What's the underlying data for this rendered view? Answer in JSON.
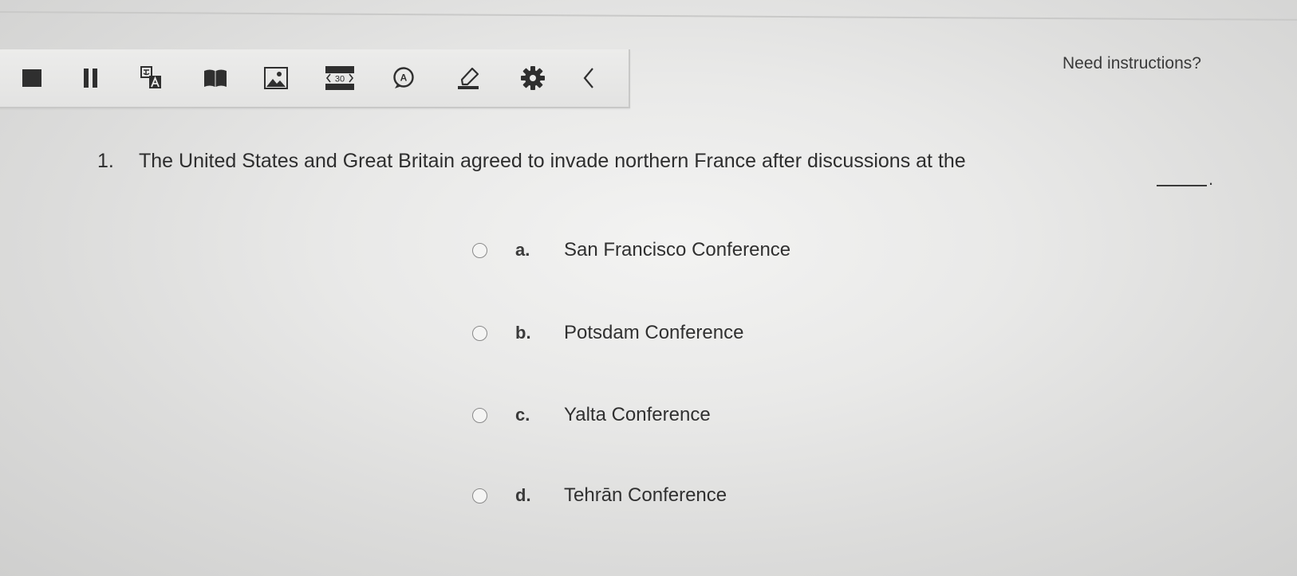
{
  "toolbar": {
    "tools": [
      {
        "icon": "stop-icon"
      },
      {
        "icon": "pause-icon"
      },
      {
        "icon": "translate-icon"
      },
      {
        "icon": "book-icon"
      },
      {
        "icon": "image-icon"
      },
      {
        "icon": "text-to-speech-icon",
        "label": "30"
      },
      {
        "icon": "answer-highlight-icon",
        "label": "A"
      },
      {
        "icon": "highlighter-icon"
      },
      {
        "icon": "gear-icon"
      },
      {
        "icon": "chevron-left-icon"
      }
    ]
  },
  "help": {
    "need_instructions": "Need instructions?"
  },
  "question": {
    "number": "1.",
    "text": "The United States and Great Britain agreed to invade northern France after discussions at the",
    "end_punctuation": "."
  },
  "options": [
    {
      "letter": "a.",
      "text": "San Francisco Conference"
    },
    {
      "letter": "b.",
      "text": "Potsdam Conference"
    },
    {
      "letter": "c.",
      "text": "Yalta Conference"
    },
    {
      "letter": "d.",
      "text": "Tehrān Conference"
    }
  ],
  "colors": {
    "icon": "#2f2f2f",
    "background": "#e9e9e8",
    "text": "#2e2e2e"
  }
}
